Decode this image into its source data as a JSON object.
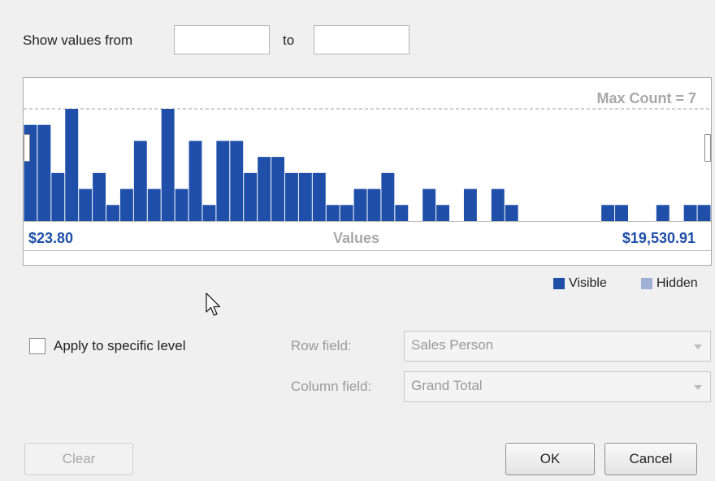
{
  "range": {
    "label_from": "Show values from",
    "from_value": "",
    "label_to": "to",
    "to_value": ""
  },
  "histogram": {
    "max_label": "Max Count = 7",
    "min_value_label": "$23.80",
    "axis_label": "Values",
    "max_value_label": "$19,530.91",
    "bar_color": "#1f4fa8",
    "hidden_color": "#a0b0d4",
    "legend": {
      "visible": "Visible",
      "hidden": "Hidden"
    }
  },
  "chart_data": {
    "type": "bar",
    "title": "",
    "xlabel": "Values",
    "ylabel": "",
    "ylim": [
      0,
      7
    ],
    "x_range_labels": [
      "$23.80",
      "$19,530.91"
    ],
    "values": [
      6,
      6,
      3,
      7,
      2,
      3,
      1,
      2,
      5,
      2,
      7,
      2,
      5,
      1,
      5,
      5,
      3,
      4,
      4,
      3,
      3,
      3,
      1,
      1,
      2,
      2,
      3,
      1,
      0,
      2,
      1,
      0,
      2,
      0,
      2,
      1,
      0,
      0,
      0,
      0,
      0,
      0,
      1,
      1,
      0,
      0,
      1,
      0,
      1,
      1
    ],
    "series": [
      {
        "name": "Visible"
      },
      {
        "name": "Hidden"
      }
    ]
  },
  "level": {
    "apply_label": "Apply to specific level",
    "apply_checked": false,
    "row_field_label": "Row field:",
    "row_field_value": "Sales Person",
    "column_field_label": "Column field:",
    "column_field_value": "Grand Total"
  },
  "buttons": {
    "clear": "Clear",
    "ok": "OK",
    "cancel": "Cancel"
  }
}
